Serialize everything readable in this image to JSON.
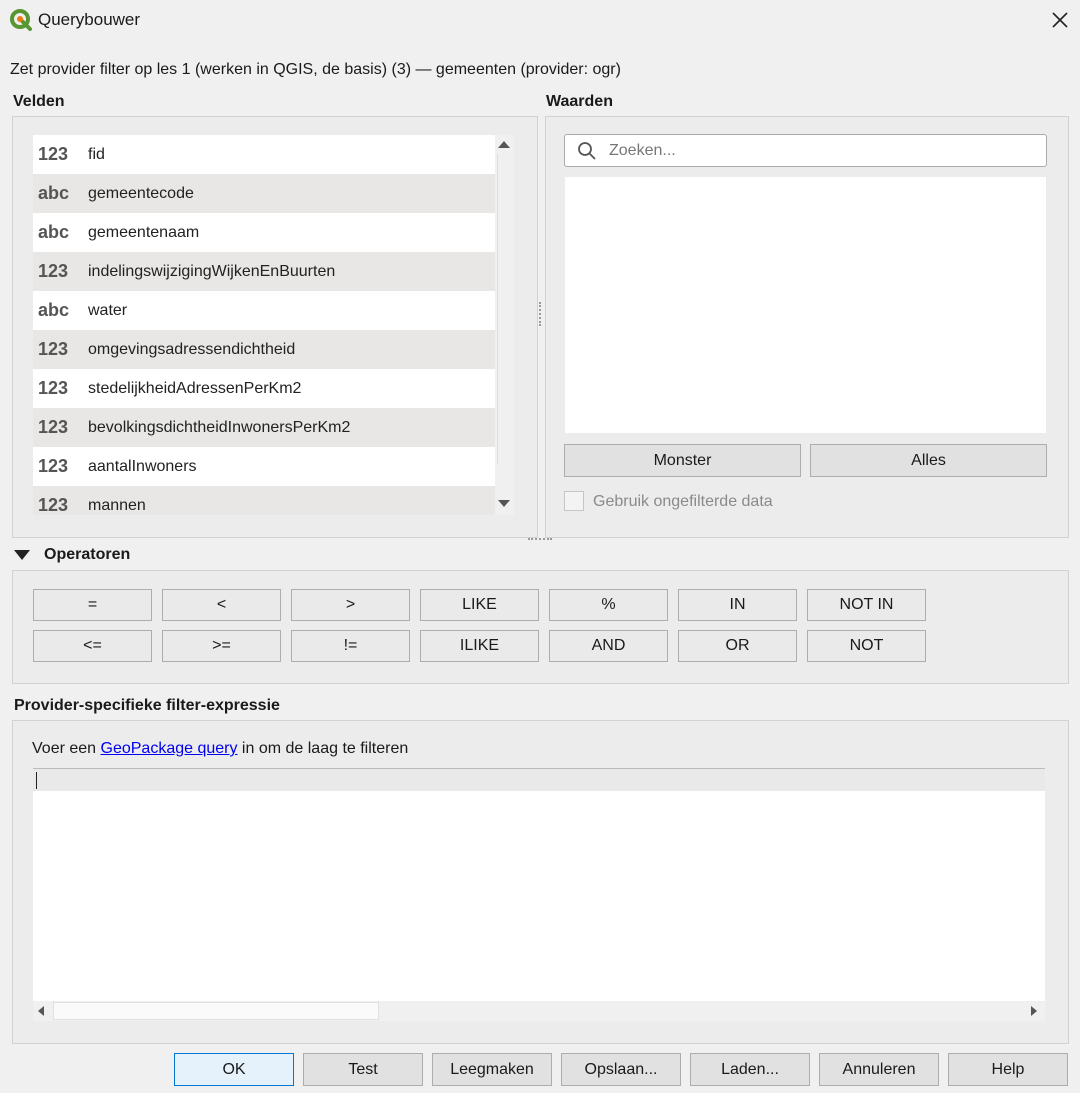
{
  "window": {
    "title": "Querybouwer",
    "subtitle": "Zet provider filter op les 1 (werken in QGIS, de basis) (3) — gemeenten (provider: ogr)"
  },
  "fields": {
    "label": "Velden",
    "items": [
      {
        "type": "123",
        "name": "fid"
      },
      {
        "type": "abc",
        "name": "gemeentecode"
      },
      {
        "type": "abc",
        "name": "gemeentenaam"
      },
      {
        "type": "123",
        "name": "indelingswijzigingWijkenEnBuurten"
      },
      {
        "type": "abc",
        "name": "water"
      },
      {
        "type": "123",
        "name": "omgevingsadressendichtheid"
      },
      {
        "type": "123",
        "name": "stedelijkheidAdressenPerKm2"
      },
      {
        "type": "123",
        "name": "bevolkingsdichtheidInwonersPerKm2"
      },
      {
        "type": "123",
        "name": "aantalInwoners"
      },
      {
        "type": "123",
        "name": "mannen"
      }
    ]
  },
  "values": {
    "label": "Waarden",
    "search_placeholder": "Zoeken...",
    "sample_button": "Monster",
    "all_button": "Alles",
    "unfiltered_label": "Gebruik ongefilterde data"
  },
  "operators": {
    "label": "Operatoren",
    "row1": [
      "=",
      "<",
      ">",
      "LIKE",
      "%",
      "IN",
      "NOT IN"
    ],
    "row2": [
      "<=",
      ">=",
      "!=",
      "ILIKE",
      "AND",
      "OR",
      "NOT"
    ]
  },
  "expression": {
    "label": "Provider-specifieke filter-expressie",
    "hint_prefix": "Voer een ",
    "hint_link": "GeoPackage query",
    "hint_suffix": " in om de laag te filteren",
    "value": ""
  },
  "footer": {
    "ok": "OK",
    "test": "Test",
    "clear": "Leegmaken",
    "save": "Opslaan...",
    "load": "Laden...",
    "cancel": "Annuleren",
    "help": "Help"
  },
  "colors": {
    "qgis_green": "#589632",
    "qgis_yellow": "#ee7913",
    "link": "#0000ee",
    "ok_border": "#0078d7"
  }
}
